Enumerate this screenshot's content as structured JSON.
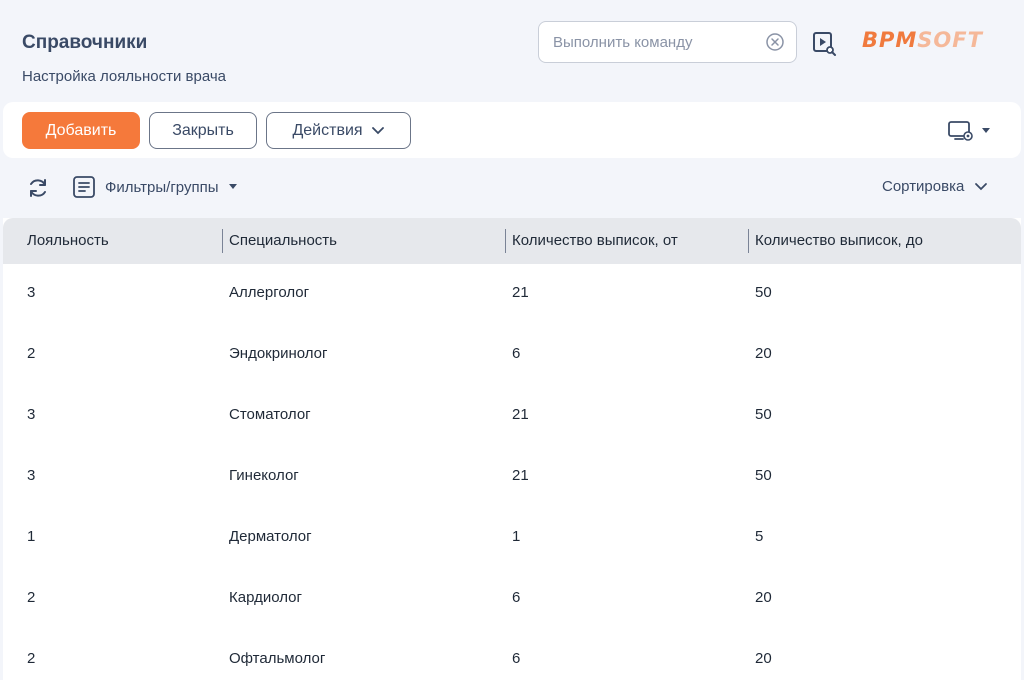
{
  "header": {
    "title": "Справочники",
    "subtitle": "Настройка лояльности врача",
    "command_placeholder": "Выполнить команду",
    "logo_part1": "BPM",
    "logo_part2": "SOFT"
  },
  "toolbar": {
    "add_label": "Добавить",
    "close_label": "Закрыть",
    "actions_label": "Действия"
  },
  "filterbar": {
    "filters_label": "Фильтры/группы",
    "sort_label": "Сортировка"
  },
  "table": {
    "columns": [
      "Лояльность",
      "Специальность",
      "Количество выписок, от",
      "Количество выписок, до"
    ],
    "rows": [
      [
        "3",
        "Аллерголог",
        "21",
        "50"
      ],
      [
        "2",
        "Эндокринолог",
        "6",
        "20"
      ],
      [
        "3",
        "Стоматолог",
        "21",
        "50"
      ],
      [
        "3",
        "Гинеколог",
        "21",
        "50"
      ],
      [
        "1",
        "Дерматолог",
        "1",
        "5"
      ],
      [
        "2",
        "Кардиолог",
        "6",
        "20"
      ],
      [
        "2",
        "Офтальмолог",
        "6",
        "20"
      ]
    ]
  },
  "colors": {
    "accent": "#f5793b",
    "text_primary": "#3a4a66",
    "background": "#f3f5fa"
  }
}
